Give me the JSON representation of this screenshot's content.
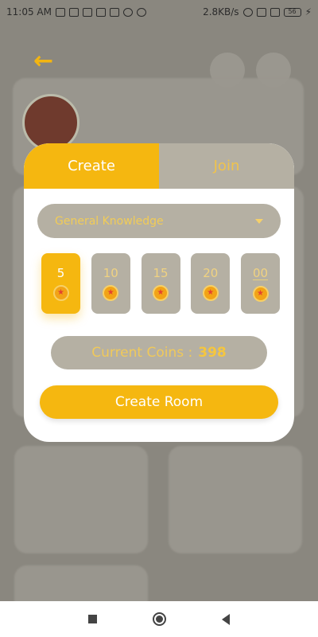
{
  "status_bar": {
    "time": "11:05 AM",
    "network_speed": "2.8KB/s",
    "battery_level": "56"
  },
  "modal": {
    "tabs": [
      {
        "label": "Create"
      },
      {
        "label": "Join"
      }
    ],
    "category": "General Knowledge",
    "coin_options": [
      "5",
      "10",
      "15",
      "20",
      "00"
    ],
    "current_coins_label": "Current Coins :",
    "current_coins_value": "398",
    "create_button_label": "Create Room"
  },
  "colors": {
    "accent": "#f5b710",
    "muted": "#b5b0a3",
    "overlay": "#8a877f"
  },
  "icons": {
    "back": "arrow-left-icon",
    "coin": "coin-star-icon",
    "dropdown": "chevron-down-icon"
  }
}
